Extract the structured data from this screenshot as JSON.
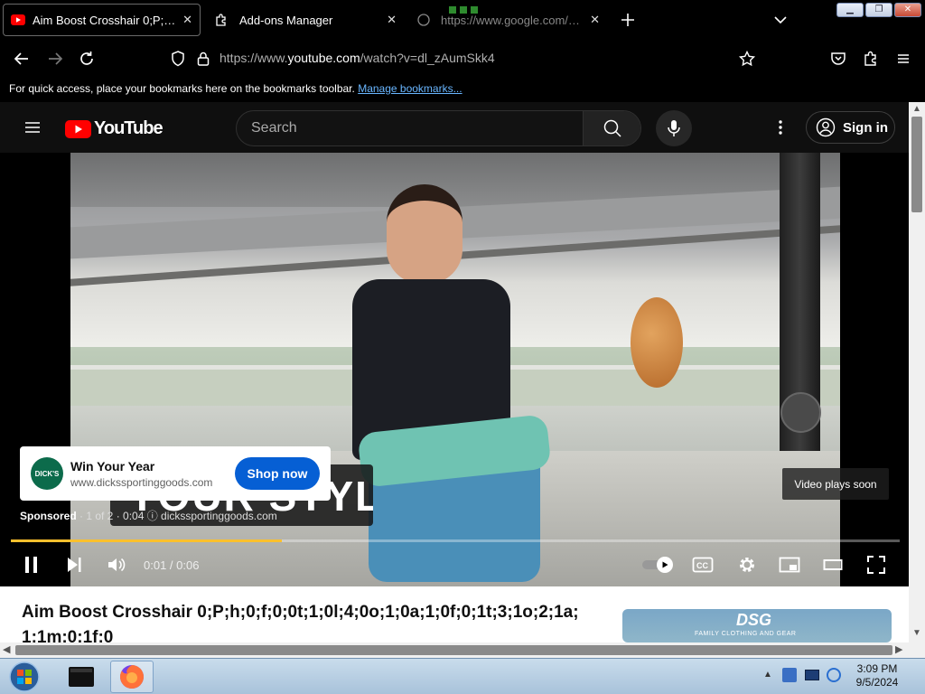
{
  "browser": {
    "tabs": [
      {
        "label": "Aim Boost Crosshair 0;P;h;0;f;0;",
        "icon": "youtube-icon"
      },
      {
        "label": "Add-ons Manager",
        "icon": "puzzle-icon"
      },
      {
        "label": "https://www.google.com/search",
        "icon": "globe-icon"
      }
    ],
    "url_prefix": "https://www.",
    "url_domain": "youtube.com",
    "url_path": "/watch?v=dl_zAumSkk4",
    "bookmarks_msg": "For quick access, place your bookmarks here on the bookmarks toolbar.",
    "bookmarks_link": "Manage bookmarks..."
  },
  "youtube": {
    "logo_text": "YouTube",
    "search_placeholder": "Search",
    "signin_label": "Sign in",
    "ad": {
      "brand": "DICK'S",
      "title": "Win Your Year",
      "url": "www.dickssportinggoods.com",
      "cta": "Shop now",
      "caption": "YOUR STYLE.",
      "sponsored": "Sponsored",
      "sponsored_rest": " · 1 of 2 · 0:04 ⓘ   dickssportinggoods.com",
      "video_plays_soon": "Video plays soon"
    },
    "player": {
      "time": "0:01 / 0:06",
      "progress_fraction": 0.305
    },
    "video_title": "Aim Boost Crosshair 0;P;h;0;f;0;0t;1;0l;4;0o;1;0a;1;0f;0;1t;3;1o;2;1a;1;1m;0;1f;0",
    "sidebar_ad_brand": "DSG",
    "sidebar_ad_tagline": "FAMILY CLOTHING AND GEAR"
  },
  "taskbar": {
    "time": "3:09 PM",
    "date": "9/5/2024"
  },
  "colors": {
    "accent_red": "#ff0000",
    "progress": "#fbc02d",
    "cta_blue": "#065fd4"
  }
}
